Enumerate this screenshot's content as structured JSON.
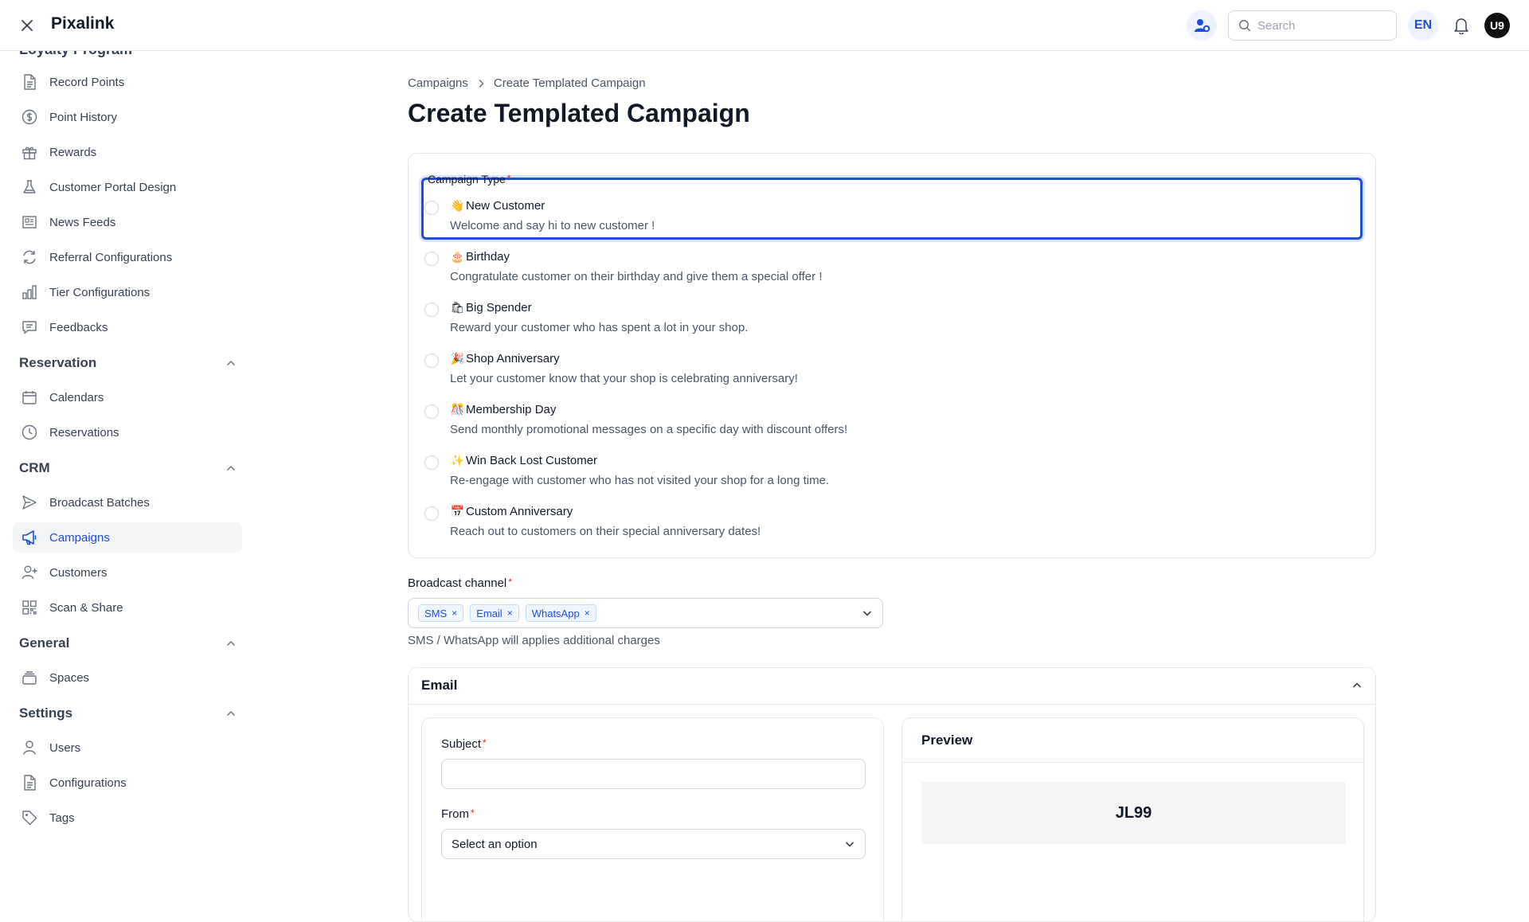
{
  "header": {
    "brand": "Pixalink",
    "search_placeholder": "Search",
    "language": "EN",
    "avatar_initials": "U9"
  },
  "sidebar": {
    "cut_heading": "Loyalty Program",
    "loyalty_items": [
      {
        "label": "Record Points",
        "icon": "document-icon"
      },
      {
        "label": "Point History",
        "icon": "dollar-circle-icon"
      },
      {
        "label": "Rewards",
        "icon": "gift-icon"
      },
      {
        "label": "Customer Portal Design",
        "icon": "flask-icon"
      },
      {
        "label": "News Feeds",
        "icon": "newspaper-icon"
      },
      {
        "label": "Referral Configurations",
        "icon": "refresh-icon"
      },
      {
        "label": "Tier Configurations",
        "icon": "bar-chart-icon"
      },
      {
        "label": "Feedbacks",
        "icon": "chat-icon"
      }
    ],
    "groups": {
      "reservation": "Reservation",
      "crm": "CRM",
      "general": "General",
      "settings": "Settings"
    },
    "reservation_items": [
      {
        "label": "Calendars",
        "icon": "calendar-icon"
      },
      {
        "label": "Reservations",
        "icon": "clock-icon"
      }
    ],
    "crm_items": [
      {
        "label": "Broadcast Batches",
        "icon": "send-icon"
      },
      {
        "label": "Campaigns",
        "icon": "megaphone-icon"
      },
      {
        "label": "Customers",
        "icon": "user-plus-icon"
      },
      {
        "label": "Scan & Share",
        "icon": "qr-icon"
      }
    ],
    "general_items": [
      {
        "label": "Spaces",
        "icon": "stack-icon"
      }
    ],
    "settings_items": [
      {
        "label": "Users",
        "icon": "user-icon"
      },
      {
        "label": "Configurations",
        "icon": "document-icon"
      },
      {
        "label": "Tags",
        "icon": "tag-icon"
      }
    ],
    "active": "Campaigns"
  },
  "breadcrumb": {
    "parent": "Campaigns",
    "current": "Create Templated Campaign"
  },
  "page_title": "Create Templated Campaign",
  "campaign_type": {
    "label": "Campaign Type",
    "required_mark": "*",
    "options": [
      {
        "emoji": "👋",
        "title": "New Customer",
        "desc": "Welcome and say hi to new customer !"
      },
      {
        "emoji": "🎂",
        "title": "Birthday",
        "desc": "Congratulate customer on their birthday and give them a special offer !"
      },
      {
        "emoji": "🛍",
        "title": "Big Spender",
        "desc": "Reward your customer who has spent a lot in your shop."
      },
      {
        "emoji": "🎉",
        "title": "Shop Anniversary",
        "desc": "Let your customer know that your shop is celebrating anniversary!"
      },
      {
        "emoji": "🎊",
        "title": "Membership Day",
        "desc": "Send monthly promotional messages on a specific day with discount offers!"
      },
      {
        "emoji": "✨",
        "title": "Win Back Lost Customer",
        "desc": "Re-engage with customer who has not visited your shop for a long time."
      },
      {
        "emoji": "📅",
        "title": "Custom Anniversary",
        "desc": "Reach out to customers on their special anniversary dates!"
      }
    ]
  },
  "broadcast": {
    "label": "Broadcast channel",
    "required_mark": "*",
    "chips": [
      "SMS",
      "Email",
      "WhatsApp"
    ],
    "chip_remove": "×",
    "hint": "SMS / WhatsApp will applies additional charges"
  },
  "email_section": {
    "title": "Email",
    "subject_label": "Subject",
    "subject_value": "",
    "from_label": "From",
    "from_value": "Select an option",
    "required_mark": "*",
    "preview_title": "Preview",
    "preview_brand": "JL99"
  },
  "colors": {
    "accent": "#1d4ed8",
    "required": "#dc2626",
    "border": "#e5e7eb"
  }
}
